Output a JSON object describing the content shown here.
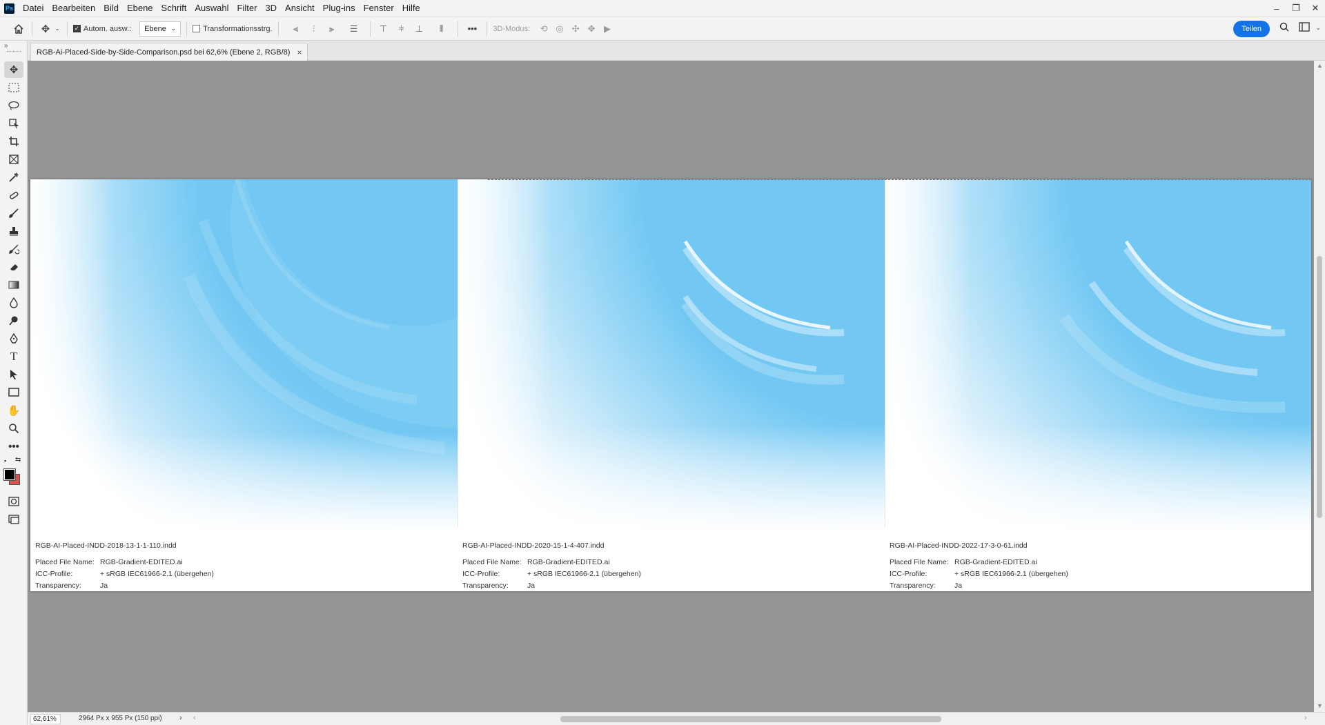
{
  "app": {
    "logo_text": "Ps"
  },
  "menu": {
    "items": [
      "Datei",
      "Bearbeiten",
      "Bild",
      "Ebene",
      "Schrift",
      "Auswahl",
      "Filter",
      "3D",
      "Ansicht",
      "Plug-ins",
      "Fenster",
      "Hilfe"
    ]
  },
  "window_controls": {
    "minimize": "–",
    "restore": "❐",
    "close": "✕"
  },
  "options": {
    "auto_select_label": "Autom. ausw.:",
    "auto_select_checked": true,
    "layer_select_value": "Ebene",
    "transform_label": "Transformationsstrg.",
    "transform_checked": false,
    "more_label": "•••",
    "mode3d_label": "3D-Modus:",
    "share_label": "Teilen"
  },
  "document": {
    "tab_title": "RGB-Ai-Placed-Side-by-Side-Comparison.psd bei 62,6% (Ebene 2, RGB/8)",
    "tab_close": "×"
  },
  "panels": [
    {
      "title": "RGB-AI-Placed-INDD-2018-13-1-1-110.indd",
      "placed_file_key": "Placed File Name:",
      "placed_file_value": "RGB-Gradient-EDITED.ai",
      "icc_key": "ICC-Profile:",
      "icc_value": "+ sRGB IEC61966-2.1 (übergehen)",
      "transparency_key": "Transparency:",
      "transparency_value": "Ja"
    },
    {
      "title": "RGB-AI-Placed-INDD-2020-15-1-4-407.indd",
      "placed_file_key": "Placed File Name:",
      "placed_file_value": "RGB-Gradient-EDITED.ai",
      "icc_key": "ICC-Profile:",
      "icc_value": "+ sRGB IEC61966-2.1 (übergehen)",
      "transparency_key": "Transparency:",
      "transparency_value": "Ja"
    },
    {
      "title": "RGB-AI-Placed-INDD-2022-17-3-0-61.indd",
      "placed_file_key": "Placed File Name:",
      "placed_file_value": "RGB-Gradient-EDITED.ai",
      "icc_key": "ICC-Profile:",
      "icc_value": "+ sRGB IEC61966-2.1 (übergehen)",
      "transparency_key": "Transparency:",
      "transparency_value": "Ja"
    }
  ],
  "status": {
    "zoom": "62,61%",
    "doc_info": "2964 Px x 955 Px (150 ppi)",
    "arrow": "›",
    "left_arrow": "‹",
    "right_arrow": "›"
  },
  "colors": {
    "accent": "#1473e6",
    "foreground_swatch": "#000000",
    "background_swatch": "#d9534f",
    "gradient_blue": "#72c8f3"
  },
  "tools": [
    "move-tool-icon",
    "marquee-tool-icon",
    "lasso-tool-icon",
    "object-select-tool-icon",
    "crop-tool-icon",
    "frame-tool-icon",
    "eyedropper-tool-icon",
    "healing-brush-tool-icon",
    "brush-tool-icon",
    "stamp-tool-icon",
    "history-brush-tool-icon",
    "eraser-tool-icon",
    "gradient-tool-icon",
    "blur-tool-icon",
    "dodge-tool-icon",
    "pen-tool-icon",
    "type-tool-icon",
    "path-select-tool-icon",
    "rectangle-tool-icon",
    "hand-tool-icon",
    "zoom-tool-icon",
    "more-tools-icon"
  ]
}
